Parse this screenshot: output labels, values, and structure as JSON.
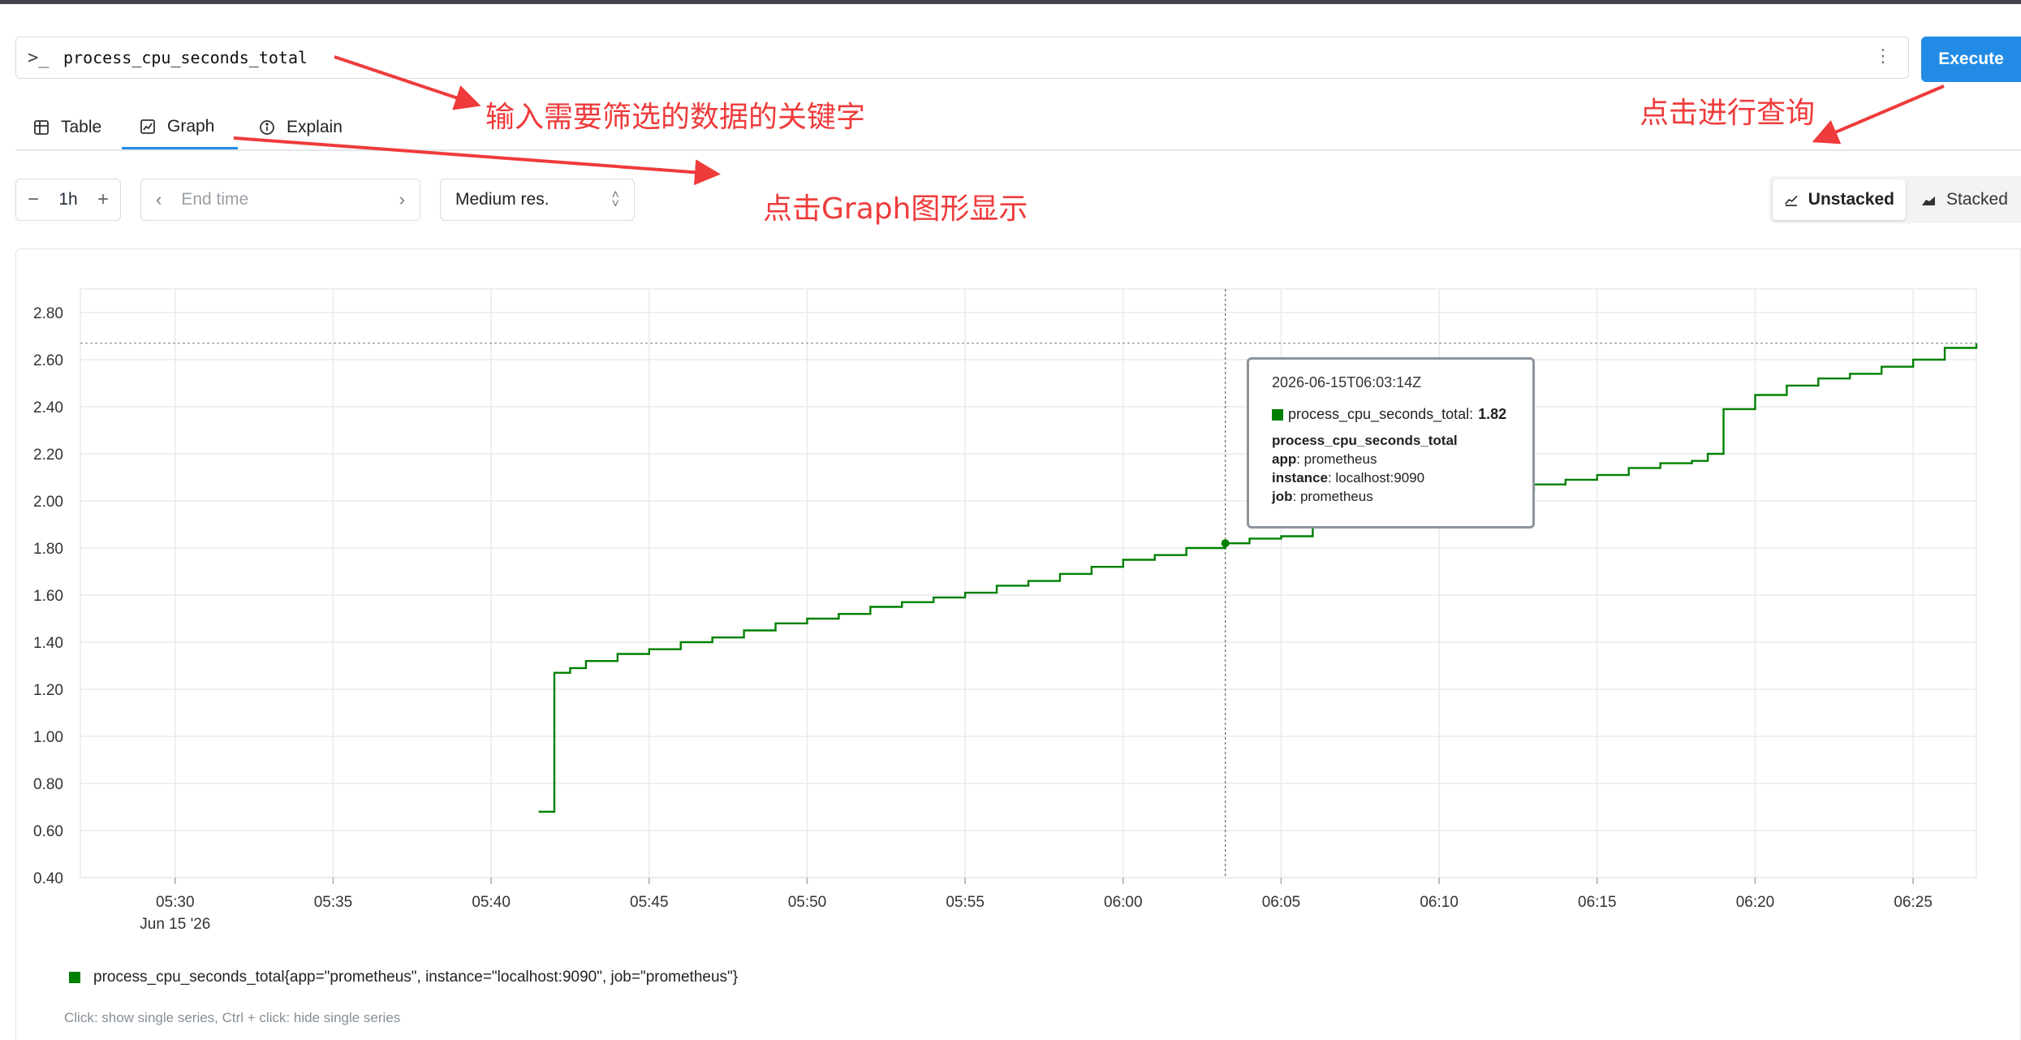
{
  "query": {
    "value": "process_cpu_seconds_total",
    "prompt_icon": "terminal-prompt-icon",
    "menu_icon": "kebab-menu-icon"
  },
  "execute_label": "Execute",
  "tabs": [
    {
      "label": "Table",
      "icon": "table-icon"
    },
    {
      "label": "Graph",
      "icon": "graph-icon",
      "active": true
    },
    {
      "label": "Explain",
      "icon": "info-icon"
    }
  ],
  "controls": {
    "range": "1h",
    "end_time_placeholder": "End time",
    "resolution": "Medium res.",
    "unstacked_label": "Unstacked",
    "stacked_label": "Stacked"
  },
  "annotations": {
    "query_note": "输入需要筛选的数据的关键字",
    "execute_note": "点击进行查询",
    "graph_note": "点击Graph图形显示"
  },
  "tooltip": {
    "time": "2026-06-15T06:03:14Z",
    "series_name": "process_cpu_seconds_total:",
    "series_value": "1.82",
    "metric": "process_cpu_seconds_total",
    "labels": [
      {
        "key": "app",
        "value": ": prometheus"
      },
      {
        "key": "instance",
        "value": ": localhost:9090"
      },
      {
        "key": "job",
        "value": ": prometheus"
      }
    ]
  },
  "legend": {
    "series": "process_cpu_seconds_total{app=\"prometheus\", instance=\"localhost:9090\", job=\"prometheus\"}",
    "hint": "Click: show single series, Ctrl + click: hide single series"
  },
  "colors": {
    "series": "#008000",
    "accent": "#228be6",
    "annotation": "#ef3b3b"
  },
  "chart_data": {
    "type": "line",
    "x_tick_labels": [
      "05:30",
      "05:35",
      "05:40",
      "05:45",
      "05:50",
      "05:55",
      "06:00",
      "06:05",
      "06:10",
      "06:15",
      "06:20",
      "06:25"
    ],
    "x_date_label": "Jun 15 '26",
    "y_tick_labels": [
      "0.40",
      "0.60",
      "0.80",
      "1.00",
      "1.20",
      "1.40",
      "1.60",
      "1.80",
      "2.00",
      "2.20",
      "2.40",
      "2.60",
      "2.80"
    ],
    "ylim": [
      0.4,
      2.9
    ],
    "xlim": [
      "05:27",
      "06:27"
    ],
    "grid": true,
    "series": [
      {
        "name": "process_cpu_seconds_total{app=\"prometheus\", instance=\"localhost:9090\", job=\"prometheus\"}",
        "x": [
          "05:41:30",
          "05:41:45",
          "05:42:00",
          "05:42:30",
          "05:43:00",
          "05:43:30",
          "05:44:00",
          "05:45:00",
          "05:46:00",
          "05:47:00",
          "05:48:00",
          "05:49:00",
          "05:50:00",
          "05:51:00",
          "05:52:00",
          "05:53:00",
          "05:54:00",
          "05:55:00",
          "05:56:00",
          "05:57:00",
          "05:58:00",
          "05:59:00",
          "06:00:00",
          "06:01:00",
          "06:02:00",
          "06:03:14",
          "06:04:00",
          "06:05:00",
          "06:06:00",
          "06:07:00",
          "06:08:00",
          "06:09:00",
          "06:10:00",
          "06:11:00",
          "06:12:00",
          "06:13:00",
          "06:14:00",
          "06:15:00",
          "06:16:00",
          "06:17:00",
          "06:18:00",
          "06:18:30",
          "06:19:00",
          "06:20:00",
          "06:21:00",
          "06:22:00",
          "06:23:00",
          "06:24:00",
          "06:25:00",
          "06:25:30",
          "06:26:00",
          "06:27:00"
        ],
        "y": [
          0.68,
          0.68,
          1.27,
          1.29,
          1.32,
          1.32,
          1.35,
          1.37,
          1.4,
          1.42,
          1.45,
          1.48,
          1.5,
          1.52,
          1.55,
          1.57,
          1.59,
          1.61,
          1.64,
          1.66,
          1.69,
          1.72,
          1.75,
          1.77,
          1.8,
          1.82,
          1.84,
          1.85,
          1.89,
          1.92,
          1.94,
          1.97,
          1.99,
          2.01,
          2.04,
          2.07,
          2.09,
          2.11,
          2.14,
          2.16,
          2.17,
          2.2,
          2.39,
          2.45,
          2.49,
          2.52,
          2.54,
          2.57,
          2.6,
          2.6,
          2.65,
          2.67
        ]
      }
    ],
    "hover": {
      "x": "06:03:14",
      "y": 1.82
    }
  }
}
